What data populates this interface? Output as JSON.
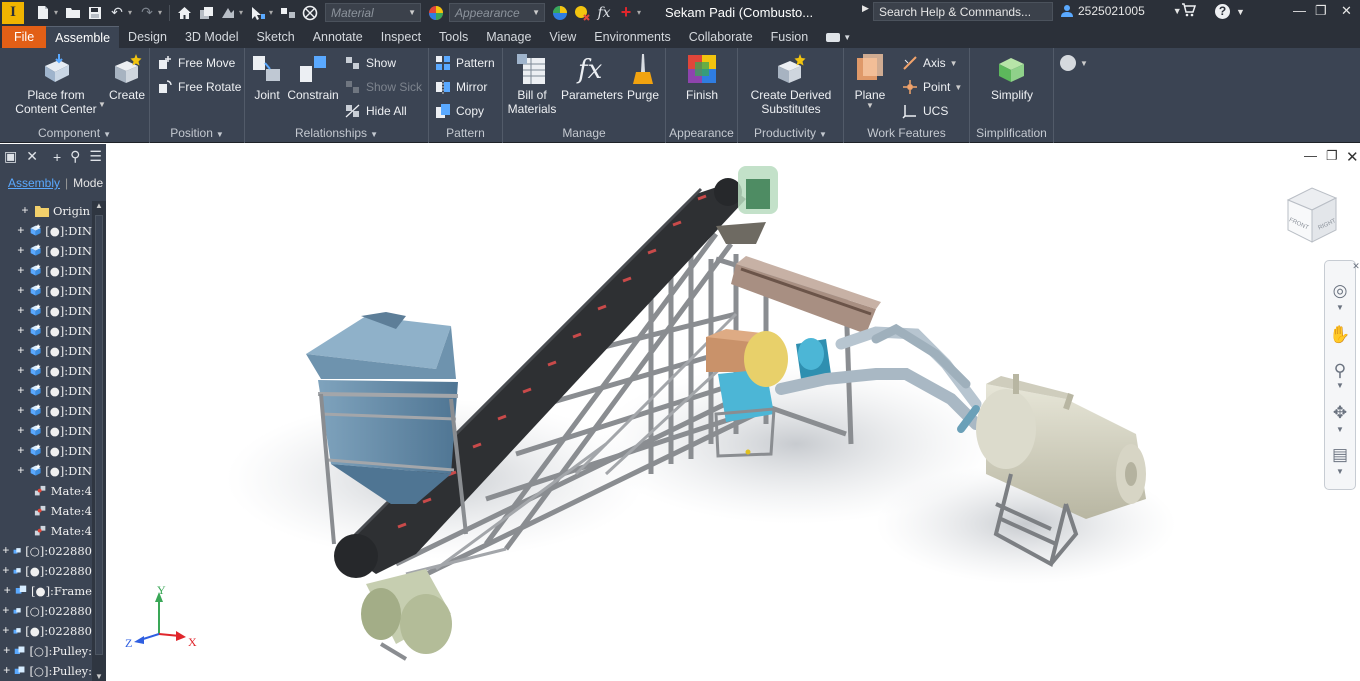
{
  "app": {
    "logo_letter": "I"
  },
  "titlebar": {
    "material_placeholder": "Material",
    "appearance_placeholder": "Appearance",
    "fx_label": "fx",
    "document_title": "Sekam Padi (Combusto...",
    "search_placeholder": "Search Help & Commands...",
    "user_id": "2525021005",
    "help_label": "?"
  },
  "tabs": {
    "file": "File",
    "assemble": "Assemble",
    "design": "Design",
    "model3d": "3D Model",
    "sketch": "Sketch",
    "annotate": "Annotate",
    "inspect": "Inspect",
    "tools": "Tools",
    "manage": "Manage",
    "view": "View",
    "environments": "Environments",
    "collaborate": "Collaborate",
    "fusion": "Fusion"
  },
  "ribbon": {
    "component": {
      "title": "Component",
      "place_line1": "Place from",
      "place_line2": "Content Center",
      "create": "Create"
    },
    "position": {
      "title": "Position",
      "free_move": "Free Move",
      "free_rotate": "Free Rotate"
    },
    "relationships": {
      "title": "Relationships",
      "joint": "Joint",
      "constrain": "Constrain",
      "show": "Show",
      "show_sick": "Show Sick",
      "hide_all": "Hide All"
    },
    "pattern": {
      "title": "Pattern",
      "pattern": "Pattern",
      "mirror": "Mirror",
      "copy": "Copy"
    },
    "manage": {
      "title": "Manage",
      "bom_line1": "Bill of",
      "bom_line2": "Materials",
      "parameters": "Parameters",
      "purge": "Purge"
    },
    "appearance": {
      "title": "Appearance",
      "finish": "Finish"
    },
    "productivity": {
      "title": "Productivity",
      "derived_line1": "Create Derived",
      "derived_line2": "Substitutes"
    },
    "work_features": {
      "title": "Work Features",
      "plane": "Plane",
      "axis": "Axis",
      "point": "Point",
      "ucs": "UCS"
    },
    "simplification": {
      "title": "Simplification",
      "simplify": "Simplify"
    }
  },
  "browser": {
    "tab_assembly": "Assembly",
    "tab_model": "Mode",
    "nodes": [
      {
        "label": "Origin",
        "icon": "folder-icon"
      },
      {
        "label": "[●]:DIN",
        "icon": "part-icon"
      },
      {
        "label": "[●]:DIN",
        "icon": "part-icon"
      },
      {
        "label": "[●]:DIN",
        "icon": "part-icon"
      },
      {
        "label": "[●]:DIN",
        "icon": "part-icon"
      },
      {
        "label": "[●]:DIN",
        "icon": "part-icon"
      },
      {
        "label": "[●]:DIN",
        "icon": "part-icon"
      },
      {
        "label": "[●]:DIN",
        "icon": "part-icon"
      },
      {
        "label": "[●]:DIN",
        "icon": "part-icon"
      },
      {
        "label": "[●]:DIN",
        "icon": "part-icon"
      },
      {
        "label": "[●]:DIN",
        "icon": "part-icon"
      },
      {
        "label": "[●]:DIN",
        "icon": "part-icon"
      },
      {
        "label": "[●]:DIN",
        "icon": "part-icon"
      },
      {
        "label": "[●]:DIN",
        "icon": "part-icon"
      },
      {
        "label": "Mate:4",
        "icon": "mate-icon"
      },
      {
        "label": "Mate:4",
        "icon": "mate-icon"
      },
      {
        "label": "Mate:4",
        "icon": "mate-icon"
      },
      {
        "label": "[○]:022880",
        "icon": "assembly-icon"
      },
      {
        "label": "[●]:022880",
        "icon": "assembly-icon"
      },
      {
        "label": "[●]:Frame",
        "icon": "assembly-icon"
      },
      {
        "label": "[○]:022880",
        "icon": "assembly-icon"
      },
      {
        "label": "[●]:022880",
        "icon": "assembly-icon"
      },
      {
        "label": "[○]:Pulley:",
        "icon": "assembly-icon"
      },
      {
        "label": "[○]:Pulley:",
        "icon": "assembly-icon"
      }
    ]
  },
  "viewport": {
    "viewcube_front": "FRONT",
    "viewcube_right": "RIGHT",
    "axis_x": "X",
    "axis_y": "Y",
    "axis_z": "Z"
  }
}
